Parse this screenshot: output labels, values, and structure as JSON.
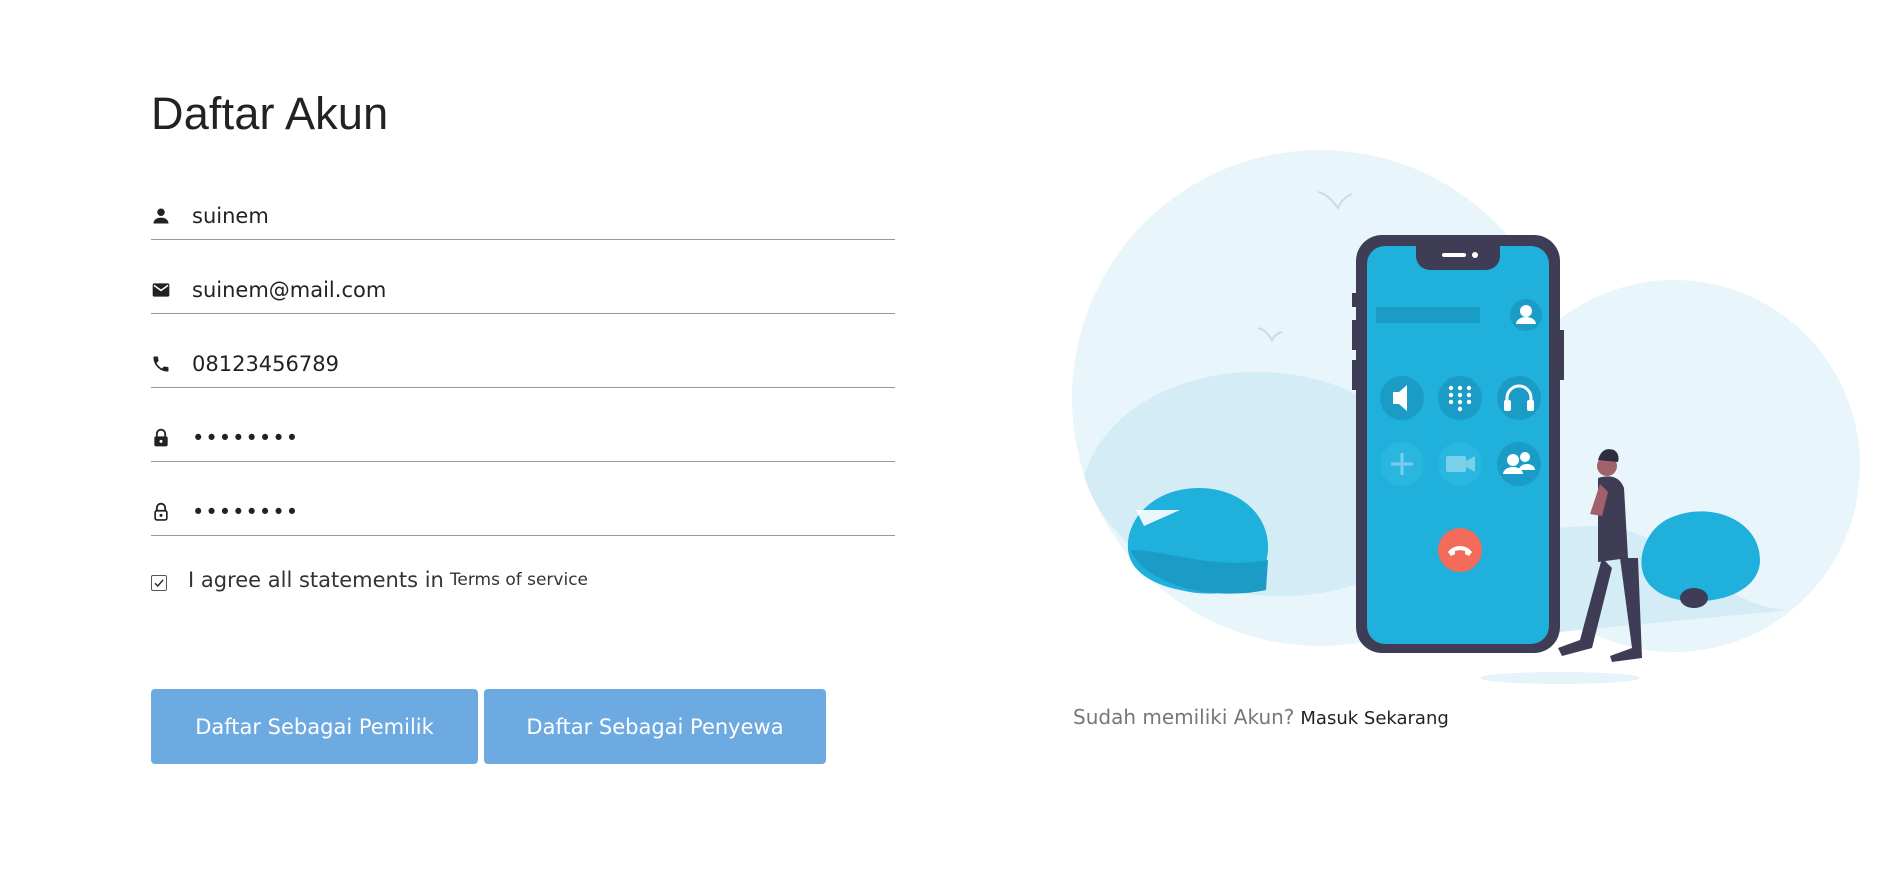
{
  "page": {
    "title": "Daftar Akun"
  },
  "form": {
    "name": {
      "icon": "person-icon",
      "value": "suinem"
    },
    "email": {
      "icon": "mail-icon",
      "value": "suinem@mail.com"
    },
    "phone": {
      "icon": "phone-icon",
      "value": "08123456789"
    },
    "password": {
      "icon": "lock-icon",
      "value": "12345678"
    },
    "confirm_password": {
      "icon": "lock-open-icon",
      "value": "12345678"
    },
    "agree": {
      "checked": true,
      "label": "I agree all statements in",
      "link": "Terms of service"
    }
  },
  "buttons": {
    "owner": "Daftar Sebagai Pemilik",
    "renter": "Daftar Sebagai Penyewa"
  },
  "login": {
    "prompt": "Sudah memiliki Akun?",
    "link": "Masuk Sekarang"
  },
  "colors": {
    "button": "#6eaae2",
    "phone_screen": "#1fb0dc",
    "phone_body": "#3f3d56",
    "background_blob": "#e8f5fb",
    "hang_up": "#f26b5b"
  }
}
